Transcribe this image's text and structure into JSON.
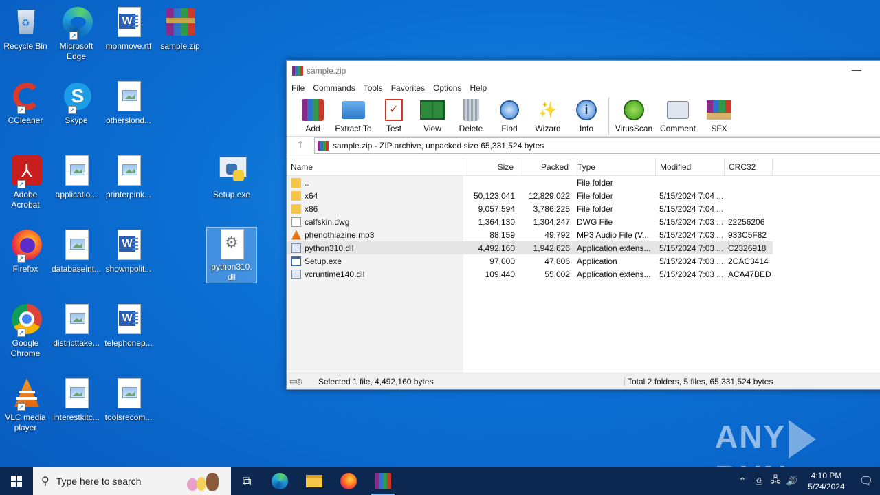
{
  "desktop": {
    "icons": [
      {
        "label": "Recycle Bin",
        "icon": "recycle-bin-icon"
      },
      {
        "label": "Microsoft Edge",
        "icon": "edge-icon"
      },
      {
        "label": "monmove.rtf",
        "icon": "word-doc-icon"
      },
      {
        "label": "sample.zip",
        "icon": "winrar-archive-icon"
      },
      {
        "label": "CCleaner",
        "icon": "ccleaner-icon"
      },
      {
        "label": "Skype",
        "icon": "skype-icon"
      },
      {
        "label": "otherslond...",
        "icon": "image-file-icon"
      },
      {
        "label": "Adobe Acrobat",
        "icon": "acrobat-icon"
      },
      {
        "label": "applicatio...",
        "icon": "image-file-icon"
      },
      {
        "label": "printerpink...",
        "icon": "image-file-icon"
      },
      {
        "label": "Setup.exe",
        "icon": "python-setup-icon"
      },
      {
        "label": "Firefox",
        "icon": "firefox-icon"
      },
      {
        "label": "databaseint...",
        "icon": "image-file-icon"
      },
      {
        "label": "shownpolit...",
        "icon": "word-doc-icon"
      },
      {
        "label": "python310.dll",
        "icon": "dll-file-icon"
      },
      {
        "label": "Google Chrome",
        "icon": "chrome-icon"
      },
      {
        "label": "districttake...",
        "icon": "image-file-icon"
      },
      {
        "label": "telephonep...",
        "icon": "word-doc-icon"
      },
      {
        "label": "VLC media player",
        "icon": "vlc-icon"
      },
      {
        "label": "interestkitc...",
        "icon": "image-file-icon"
      },
      {
        "label": "toolsrecom...",
        "icon": "image-file-icon"
      }
    ]
  },
  "winrar": {
    "title": "sample.zip",
    "menu": [
      "File",
      "Commands",
      "Tools",
      "Favorites",
      "Options",
      "Help"
    ],
    "toolbar": [
      "Add",
      "Extract To",
      "Test",
      "View",
      "Delete",
      "Find",
      "Wizard",
      "Info",
      "VirusScan",
      "Comment",
      "SFX"
    ],
    "address": "sample.zip - ZIP archive, unpacked size 65,331,524 bytes",
    "columns": [
      "Name",
      "Size",
      "Packed",
      "Type",
      "Modified",
      "CRC32"
    ],
    "rows": [
      {
        "name": "..",
        "size": "",
        "packed": "",
        "type": "File folder",
        "modified": "",
        "crc": "",
        "icon": "folder"
      },
      {
        "name": "x64",
        "size": "50,123,041",
        "packed": "12,829,022",
        "type": "File folder",
        "modified": "5/15/2024 7:04 ...",
        "crc": "",
        "icon": "folder"
      },
      {
        "name": "x86",
        "size": "9,057,594",
        "packed": "3,786,225",
        "type": "File folder",
        "modified": "5/15/2024 7:04 ...",
        "crc": "",
        "icon": "folder"
      },
      {
        "name": "calfskin.dwg",
        "size": "1,364,130",
        "packed": "1,304,247",
        "type": "DWG File",
        "modified": "5/15/2024 7:03 ...",
        "crc": "22256206",
        "icon": "file"
      },
      {
        "name": "phenothiazine.mp3",
        "size": "88,159",
        "packed": "49,792",
        "type": "MP3 Audio File (V...",
        "modified": "5/15/2024 7:03 ...",
        "crc": "933C5F82",
        "icon": "vlc"
      },
      {
        "name": "python310.dll",
        "size": "4,492,160",
        "packed": "1,942,626",
        "type": "Application extens...",
        "modified": "5/15/2024 7:03 ...",
        "crc": "C2326918",
        "icon": "dll"
      },
      {
        "name": "Setup.exe",
        "size": "97,000",
        "packed": "47,806",
        "type": "Application",
        "modified": "5/15/2024 7:03 ...",
        "crc": "2CAC3414",
        "icon": "exe"
      },
      {
        "name": "vcruntime140.dll",
        "size": "109,440",
        "packed": "55,002",
        "type": "Application extens...",
        "modified": "5/15/2024 7:03 ...",
        "crc": "ACA47BED",
        "icon": "dll"
      }
    ],
    "selected_row": 5,
    "status_left": "Selected 1 file, 4,492,160 bytes",
    "status_right": "Total 2 folders, 5 files, 65,331,524 bytes"
  },
  "taskbar": {
    "search_placeholder": "Type here to search",
    "time": "4:10 PM",
    "date": "5/24/2024"
  },
  "watermark": {
    "left": "ANY",
    "right": "RUN"
  }
}
